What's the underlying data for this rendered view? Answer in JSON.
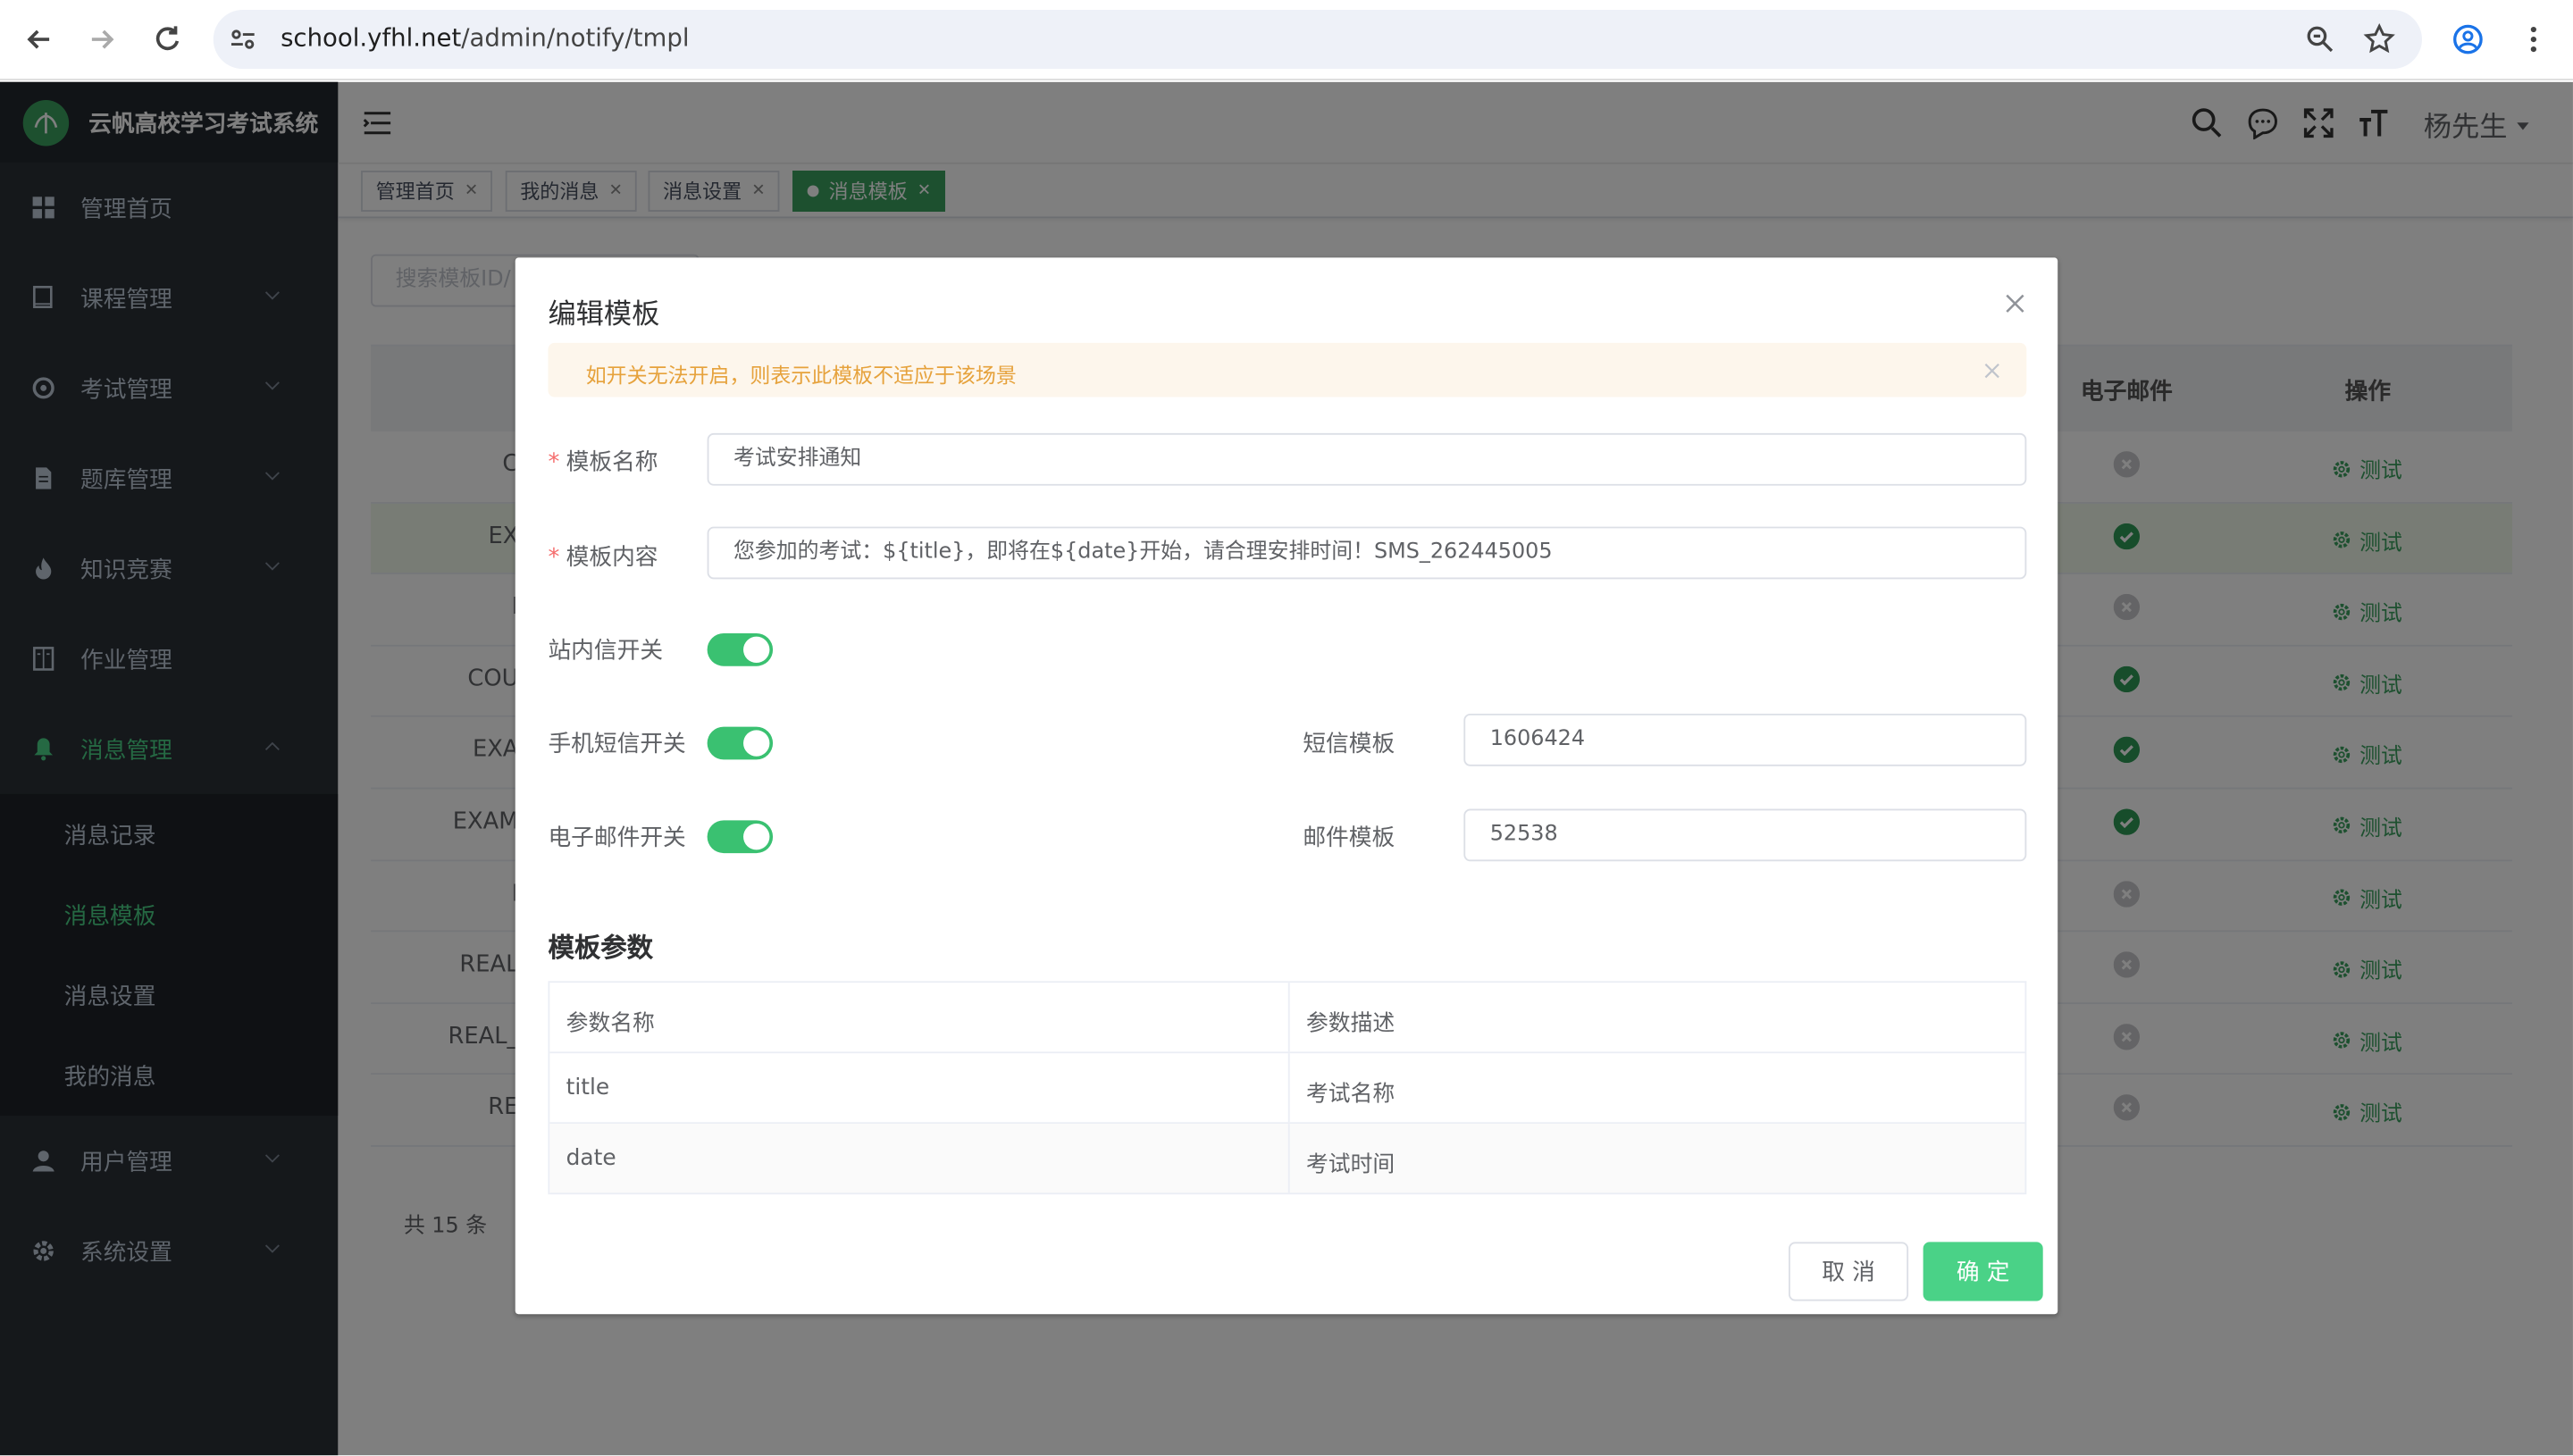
{
  "browser": {
    "url_host": "school.yfhl.net",
    "url_path": "/admin/notify/tmpl"
  },
  "app": {
    "title": "云帆高校学习考试系统",
    "user": "杨先生"
  },
  "sidebar": {
    "items": [
      {
        "label": "管理首页",
        "icon": "dashboard-icon"
      },
      {
        "label": "课程管理",
        "icon": "book-icon"
      },
      {
        "label": "考试管理",
        "icon": "target-icon"
      },
      {
        "label": "题库管理",
        "icon": "document-icon"
      },
      {
        "label": "知识竞赛",
        "icon": "flame-icon"
      },
      {
        "label": "作业管理",
        "icon": "notebook-icon"
      },
      {
        "label": "消息管理",
        "icon": "bell-icon"
      },
      {
        "label": "用户管理",
        "icon": "user-icon"
      },
      {
        "label": "系统设置",
        "icon": "gear-icon"
      }
    ],
    "submenu": [
      "消息记录",
      "消息模板",
      "消息设置",
      "我的消息"
    ]
  },
  "tags": [
    "管理首页",
    "我的消息",
    "消息设置",
    "消息模板"
  ],
  "background": {
    "search_placeholder": "搜索模板ID/",
    "col_email": "电子邮件",
    "col_op": "操作",
    "rows": [
      {
        "code": "C",
        "email": false
      },
      {
        "code": "EX",
        "email": true
      },
      {
        "code": "I",
        "email": false
      },
      {
        "code": "COU",
        "email": true
      },
      {
        "code": "EXA",
        "email": true
      },
      {
        "code": "EXAM",
        "email": true
      },
      {
        "code": "I",
        "email": false
      },
      {
        "code": "REAL",
        "email": false
      },
      {
        "code": "REAL_",
        "email": false
      },
      {
        "code": "RE",
        "email": false
      }
    ],
    "op_label": "测试",
    "total": "共 15 条"
  },
  "dialog": {
    "title": "编辑模板",
    "alert": "如开关无法开启，则表示此模板不适应于该场景",
    "name_label": "模板名称",
    "name_value": "考试安排通知",
    "content_label": "模板内容",
    "content_value": "您参加的考试：${title}，即将在${date}开始，请合理安排时间！SMS_262445005",
    "inbox_label": "站内信开关",
    "sms_label": "手机短信开关",
    "email_label": "电子邮件开关",
    "sms_tpl_label": "短信模板",
    "sms_tpl_value": "1606424",
    "email_tpl_label": "邮件模板",
    "email_tpl_value": "52538",
    "params_title": "模板参数",
    "params_head": [
      "参数名称",
      "参数描述"
    ],
    "params": [
      [
        "title",
        "考试名称"
      ],
      [
        "date",
        "考试时间"
      ]
    ],
    "cancel": "取 消",
    "confirm": "确 定"
  },
  "colors": {
    "accent": "#3aa15f",
    "switch_on": "#3ac171",
    "sidebar_bg": "#2b3037"
  }
}
